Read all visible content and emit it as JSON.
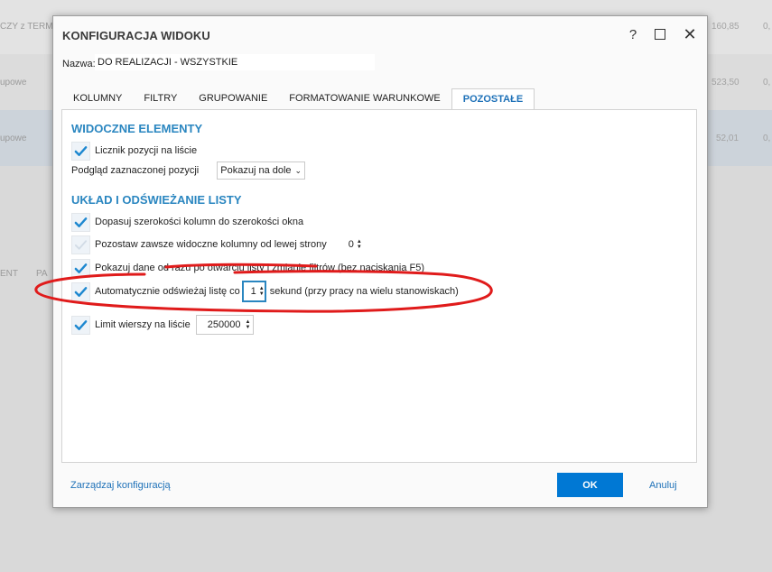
{
  "background": {
    "header_text": "CZY z TERMO",
    "rows": [
      {
        "label": "upowe",
        "value": "523,50",
        "extra": "0,"
      },
      {
        "label": "upowe",
        "value": "52,01",
        "extra": "0,"
      }
    ],
    "header_value": "160,85",
    "header_extra": "0,",
    "column_labels": [
      "ENT",
      "PA"
    ]
  },
  "dialog": {
    "title": "KONFIGURACJA WIDOKU",
    "help_glyph": "?",
    "close_glyph": "✕",
    "name_label": "Nazwa:",
    "name_value": "DO REALIZACJI - WSZYSTKIE",
    "tabs": [
      {
        "label": "KOLUMNY",
        "active": false
      },
      {
        "label": "FILTRY",
        "active": false
      },
      {
        "label": "GRUPOWANIE",
        "active": false
      },
      {
        "label": "FORMATOWANIE WARUNKOWE",
        "active": false
      },
      {
        "label": "POZOSTAŁE",
        "active": true
      }
    ],
    "visible_section": {
      "title": "WIDOCZNE ELEMENTY",
      "item_counter_label": "Licznik pozycji na liście",
      "item_counter_checked": true,
      "preview_label": "Podgląd zaznaczonej pozycji",
      "preview_value": "Pokazuj na dole"
    },
    "layout_section": {
      "title": "UKŁAD I ODŚWIEŻANIE LISTY",
      "fit_columns_label": "Dopasuj szerokości kolumn do szerokości okna",
      "fit_columns_checked": true,
      "sticky_columns_label": "Pozostaw zawsze widoczne kolumny od lewej strony",
      "sticky_columns_checked": false,
      "sticky_columns_value": "0",
      "show_data_label": "Pokazuj dane od razu po otwarciu listy i zmianie filtrów (bez naciskania F5)",
      "show_data_checked": true,
      "auto_refresh_label": "Automatycznie odświeżaj listę co",
      "auto_refresh_checked": true,
      "auto_refresh_value": "1",
      "auto_refresh_suffix": "sekund (przy pracy na wielu stanowiskach)",
      "row_limit_label": "Limit wierszy na liście",
      "row_limit_checked": true,
      "row_limit_value": "250000"
    },
    "footer": {
      "manage_label": "Zarządzaj konfiguracją",
      "ok_label": "OK",
      "cancel_label": "Anuluj"
    }
  },
  "colors": {
    "accent": "#0078d4",
    "section_title": "#2a86c0",
    "check": "#1e88d0",
    "annotation": "#e01b1b"
  }
}
